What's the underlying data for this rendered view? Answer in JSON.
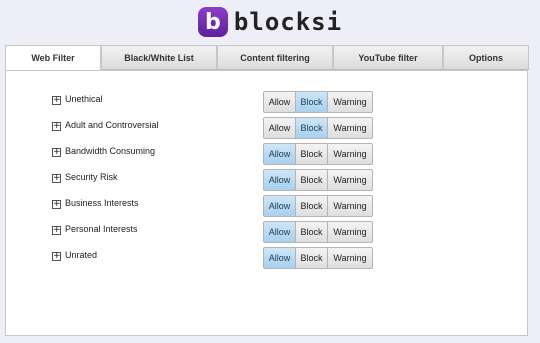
{
  "brand": {
    "logo_letter": "b",
    "name": "blocksi",
    "accent": "#6a2bb0"
  },
  "tabs": [
    {
      "label": "Web Filter",
      "active": true
    },
    {
      "label": "Black/White List",
      "active": false
    },
    {
      "label": "Content filtering",
      "active": false
    },
    {
      "label": "YouTube filter",
      "active": false
    },
    {
      "label": "Options",
      "active": false
    }
  ],
  "filter": {
    "options": [
      "Allow",
      "Block",
      "Warning"
    ],
    "expand_symbol": "+",
    "selected_color": "#b3d8f2",
    "categories": [
      {
        "label": "Unethical",
        "selected": "Block"
      },
      {
        "label": "Adult and Controversial",
        "selected": "Block"
      },
      {
        "label": "Bandwidth Consuming",
        "selected": "Allow"
      },
      {
        "label": "Security Risk",
        "selected": "Allow"
      },
      {
        "label": "Business Interests",
        "selected": "Allow"
      },
      {
        "label": "Personal Interests",
        "selected": "Allow"
      },
      {
        "label": "Unrated",
        "selected": "Allow"
      }
    ]
  }
}
